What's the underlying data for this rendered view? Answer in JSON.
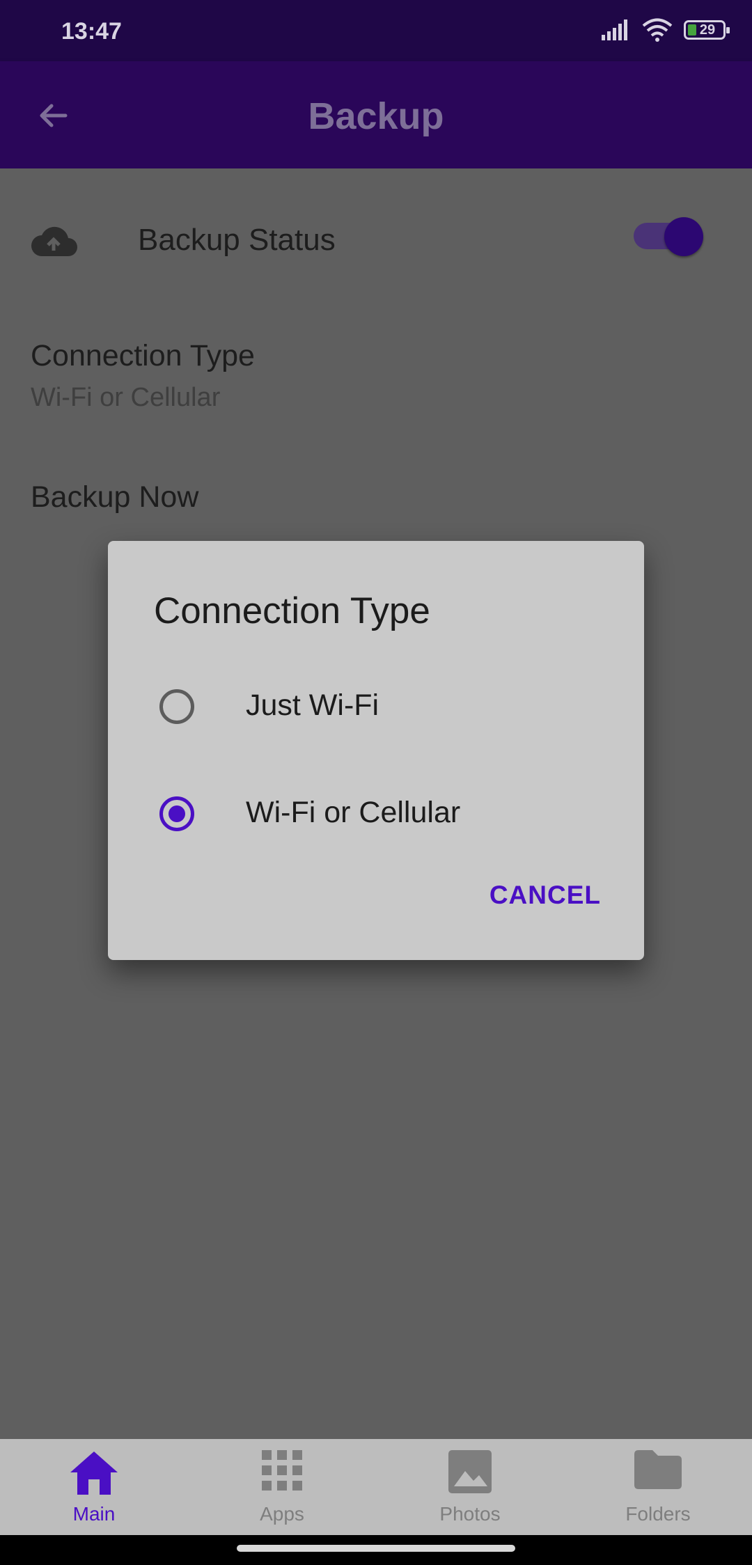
{
  "status_bar": {
    "time": "13:47",
    "battery_level": "29"
  },
  "app_bar": {
    "title": "Backup"
  },
  "settings": {
    "backup_status_label": "Backup Status",
    "backup_status_on": true,
    "connection_type_title": "Connection Type",
    "connection_type_value": "Wi-Fi or Cellular",
    "backup_now_label": "Backup Now"
  },
  "dialog": {
    "title": "Connection Type",
    "options": [
      {
        "label": "Just Wi-Fi",
        "selected": false
      },
      {
        "label": "Wi-Fi or Cellular",
        "selected": true
      }
    ],
    "cancel_label": "CANCEL"
  },
  "bottom_nav": {
    "items": [
      {
        "label": "Main",
        "icon": "home-icon",
        "active": true
      },
      {
        "label": "Apps",
        "icon": "apps-grid-icon",
        "active": false
      },
      {
        "label": "Photos",
        "icon": "image-icon",
        "active": false
      },
      {
        "label": "Folders",
        "icon": "folder-icon",
        "active": false
      }
    ]
  },
  "colors": {
    "accent": "#4a0fc4",
    "app_bar": "#2a0659",
    "status_bar": "#1f0747",
    "scrim_background": "#5f5f5f",
    "dialog_background": "#c9c9c9"
  }
}
